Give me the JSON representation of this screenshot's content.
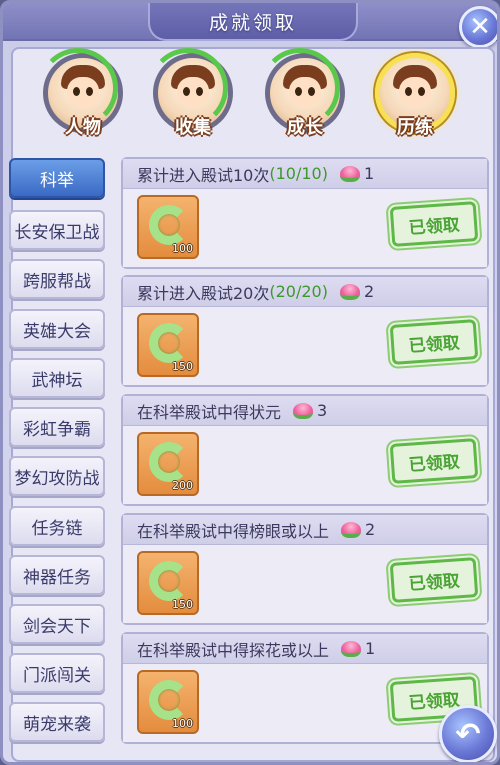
{
  "window": {
    "title": "成就领取"
  },
  "icons": {
    "close": "close-icon",
    "back": "back-arrow-icon",
    "reward": "lotus-flower-icon",
    "item": "jade-ring-icon"
  },
  "categories": [
    {
      "label": "人物",
      "active": false
    },
    {
      "label": "收集",
      "active": false
    },
    {
      "label": "成长",
      "active": false
    },
    {
      "label": "历练",
      "active": true
    }
  ],
  "sidebar": {
    "items": [
      {
        "label": "科举",
        "active": true
      },
      {
        "label": "长安保卫战",
        "active": false
      },
      {
        "label": "跨服帮战",
        "active": false
      },
      {
        "label": "英雄大会",
        "active": false
      },
      {
        "label": "武神坛",
        "active": false
      },
      {
        "label": "彩虹争霸",
        "active": false
      },
      {
        "label": "梦幻攻防战",
        "active": false
      },
      {
        "label": "任务链",
        "active": false
      },
      {
        "label": "神器任务",
        "active": false
      },
      {
        "label": "剑会天下",
        "active": false
      },
      {
        "label": "门派闯关",
        "active": false
      },
      {
        "label": "萌宠来袭",
        "active": false
      }
    ]
  },
  "achievements": [
    {
      "title": "累计进入殿试10次",
      "progress": "(10/10)",
      "reward_count": "1",
      "item_qty": "100",
      "status": "已领取"
    },
    {
      "title": "累计进入殿试20次",
      "progress": "(20/20)",
      "reward_count": "2",
      "item_qty": "150",
      "status": "已领取"
    },
    {
      "title": "在科举殿试中得状元",
      "progress": "",
      "reward_count": "3",
      "item_qty": "200",
      "status": "已领取"
    },
    {
      "title": "在科举殿试中得榜眼或以上",
      "progress": "",
      "reward_count": "2",
      "item_qty": "150",
      "status": "已领取"
    },
    {
      "title": "在科举殿试中得探花或以上",
      "progress": "",
      "reward_count": "1",
      "item_qty": "100",
      "status": "已领取"
    }
  ]
}
